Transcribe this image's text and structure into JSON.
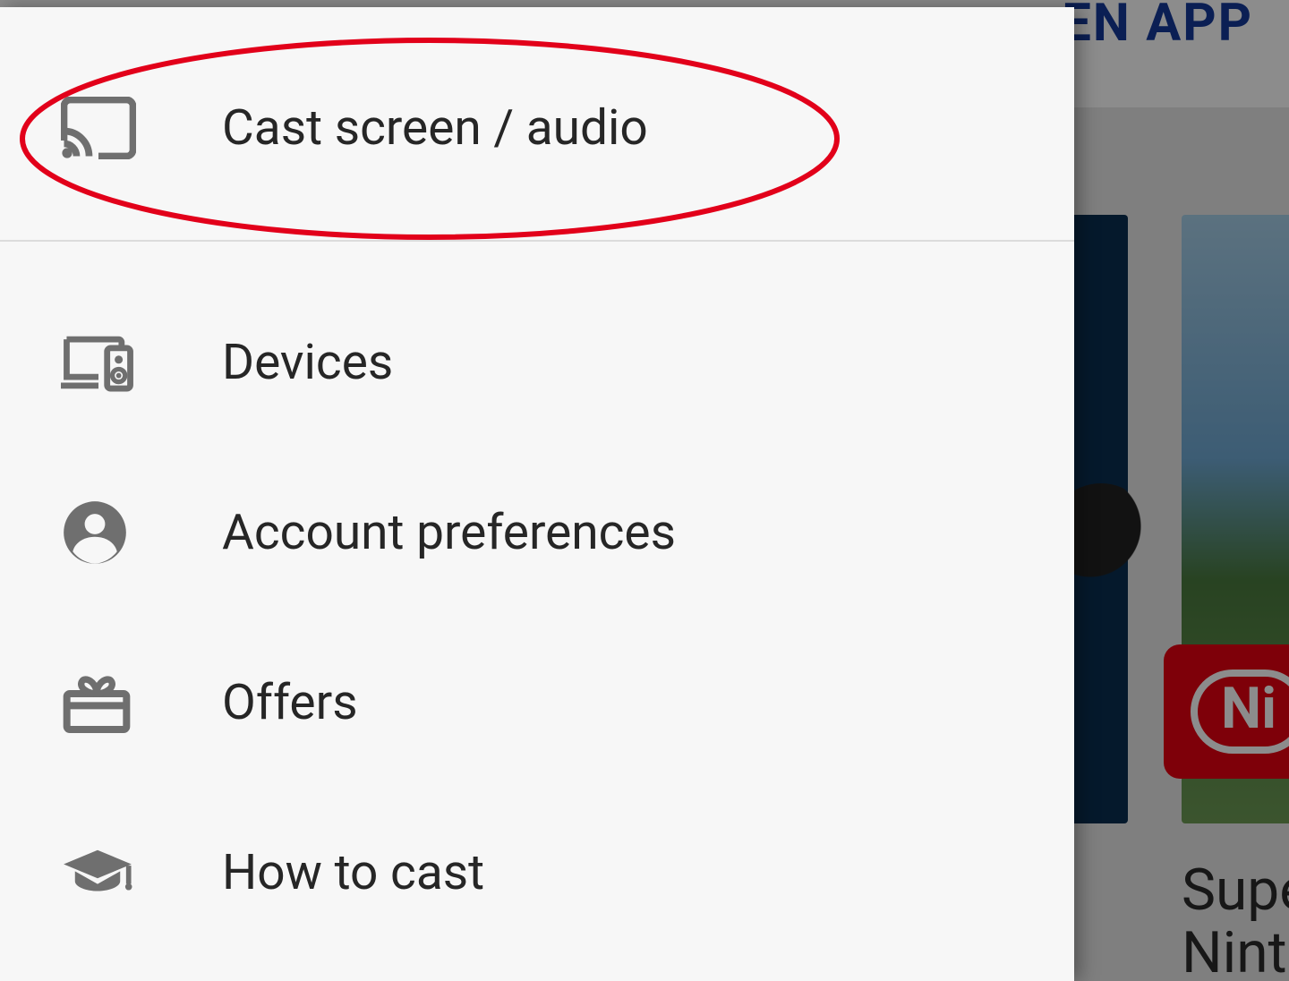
{
  "background": {
    "open_app_label": "EN APP",
    "nintendo_fragment": "Ni",
    "caption_line1": "Supe",
    "caption_line2": "Ninte"
  },
  "drawer": {
    "items": [
      {
        "label": "Cast screen / audio"
      },
      {
        "label": "Devices"
      },
      {
        "label": "Account preferences"
      },
      {
        "label": "Offers"
      },
      {
        "label": "How to cast"
      }
    ]
  },
  "annotation": {
    "highlight_target": "cast-screen-audio",
    "color": "#e2001a"
  }
}
